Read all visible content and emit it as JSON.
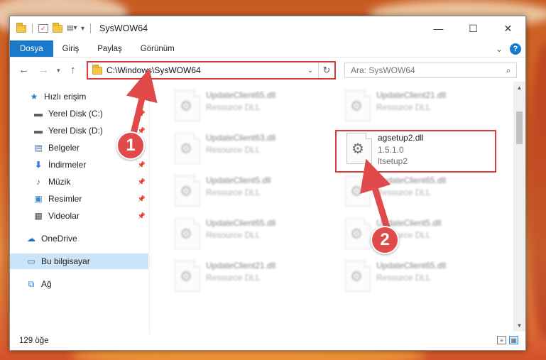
{
  "window": {
    "title": "SysWOW64",
    "controls": {
      "minimize": "—",
      "maximize": "☐",
      "close": "✕"
    }
  },
  "ribbon": {
    "tabs": [
      "Dosya",
      "Giriş",
      "Paylaş",
      "Görünüm"
    ],
    "expand": "⌄",
    "help": "?"
  },
  "address": {
    "path": "C:\\Windows\\SysWOW64",
    "search_placeholder": "Ara: SysWOW64"
  },
  "nav": {
    "items": [
      {
        "label": "Hızlı erişim",
        "icon": "star-icon",
        "pinned": false
      },
      {
        "label": "Yerel Disk (C:)",
        "icon": "drive-icon",
        "pinned": true
      },
      {
        "label": "Yerel Disk (D:)",
        "icon": "drive-icon",
        "pinned": true
      },
      {
        "label": "Belgeler",
        "icon": "documents-icon",
        "pinned": true
      },
      {
        "label": "İndirmeler",
        "icon": "download-icon",
        "pinned": true
      },
      {
        "label": "Müzik",
        "icon": "music-icon",
        "pinned": true
      },
      {
        "label": "Resimler",
        "icon": "pictures-icon",
        "pinned": true
      },
      {
        "label": "Videolar",
        "icon": "video-icon",
        "pinned": true
      },
      {
        "label": "OneDrive",
        "icon": "cloud-icon",
        "pinned": false
      },
      {
        "label": "Bu bilgisayar",
        "icon": "computer-icon",
        "pinned": false,
        "selected": true
      },
      {
        "label": "Ağ",
        "icon": "network-icon",
        "pinned": false
      }
    ]
  },
  "files": [
    {
      "name": "UpdateClient65.dll",
      "sub": "Resource DLL"
    },
    {
      "name": "UpdateClient21.dll",
      "sub": "Resource DLL"
    },
    {
      "name": "UpdateClient63.dll",
      "sub": "Resource DLL"
    },
    {
      "name": "agsetup2.dll",
      "sub": "1.5.1.0",
      "sub2": "ltsetup2",
      "highlighted": true
    },
    {
      "name": "UpdateClient5.dll",
      "sub": "Resource DLL"
    },
    {
      "name": "UpdateClient65.dll",
      "sub": "Resource DLL"
    },
    {
      "name": "UpdateClient65.dll",
      "sub": "Resource DLL"
    },
    {
      "name": "UpdateClient5.dll",
      "sub": "Resource DLL"
    },
    {
      "name": "UpdateClient21.dll",
      "sub": "Resource DLL"
    },
    {
      "name": "UpdateClient65.dll",
      "sub": "Resource DLL"
    }
  ],
  "status": {
    "count": "129 öğe"
  },
  "annotations": {
    "step1": "1",
    "step2": "2",
    "color": "#e04a4a"
  }
}
